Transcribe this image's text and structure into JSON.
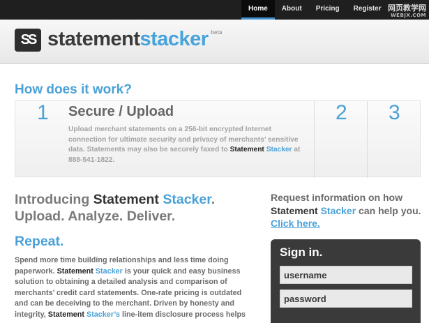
{
  "nav": {
    "items": [
      {
        "label": "Home"
      },
      {
        "label": "About"
      },
      {
        "label": "Pricing"
      },
      {
        "label": "Register"
      }
    ]
  },
  "watermark": {
    "line1": "网页教学网",
    "line2": "WEBJX.COM"
  },
  "logo": {
    "mark": "SS",
    "word1": "statement",
    "word2": "stacker",
    "beta": "beta"
  },
  "how": {
    "title": "How does it work?",
    "steps": [
      {
        "number": "1",
        "title": "Secure / Upload",
        "desc_prefix": "Upload merchant statements on a 256-bit encrypted Internet connection for ultimate security and privacy of merchants’ sensitive data. Statements may also be securely faxed to ",
        "desc_brand1": "Statement",
        "desc_brand2": "Stacker",
        "desc_suffix": " at 888-541-1822."
      },
      {
        "number": "2"
      },
      {
        "number": "3"
      }
    ]
  },
  "intro": {
    "line1_prefix": "Introducing ",
    "brand1": "Statement",
    "brand2": "Stacker",
    "line1_suffix": ".",
    "line2": "Upload. Analyze. Deliver.",
    "repeat": "Repeat.",
    "body_p1": "Spend more time building relationships and less time doing paperwork. ",
    "body_brand1": "Statement",
    "body_brand2": "Stacker",
    "body_p2": " is your quick and easy business solution to obtaining a detailed analysis and comparison of merchants’ credit card statements. One-rate pricing is outdated and can be deceiving to the merchant. Driven by honesty and integrity, ",
    "body_brand3": "Statement",
    "body_brand4": "Stacker’s",
    "body_p3": " line-item disclosure process helps"
  },
  "request": {
    "prefix": "Request information on how ",
    "brand1": "Statement",
    "brand2": "Stacker",
    "middle": " can help you. ",
    "link": "Click here."
  },
  "signin": {
    "title": "Sign in.",
    "username_placeholder": "username",
    "password_placeholder": "password"
  },
  "colors": {
    "accent": "#4aa1d8",
    "nav_bg": "#1f1f1f",
    "panel_bg": "#3a3a3a"
  }
}
